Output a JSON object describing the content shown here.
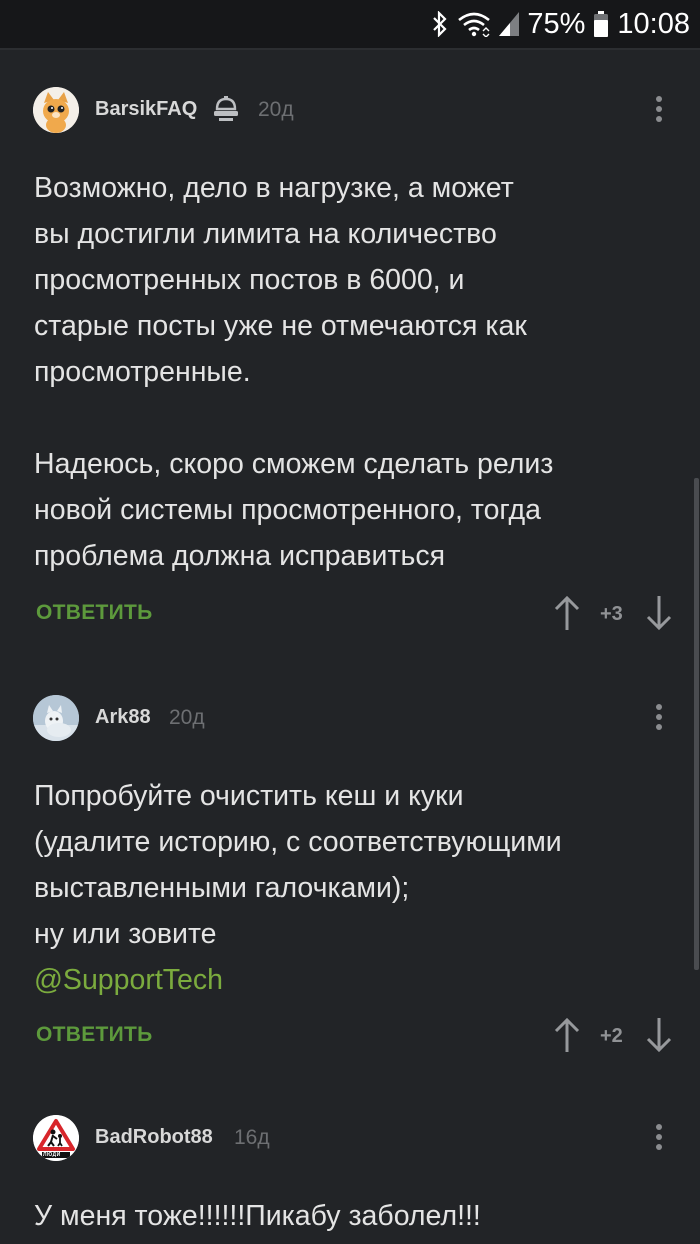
{
  "status_bar": {
    "icons": [
      "bluetooth-icon",
      "wifi-icon",
      "signal-icon",
      "battery-icon"
    ],
    "battery": "75%",
    "time": "10:08"
  },
  "comments": [
    {
      "author": "BarsikFAQ",
      "badge_icon": "moderator-hat-icon",
      "time": "20д",
      "paragraphs": [
        "Возможно, дело в нагрузке, а может",
        "вы достигли лимита на количество",
        "просмотренных постов в 6000, и",
        "старые посты уже не отмечаются как",
        "просмотренные.",
        "",
        "Надеюсь, скоро сможем сделать релиз",
        "новой системы просмотренного, тогда",
        "проблема должна исправиться"
      ],
      "reply_label": "ОТВЕТИТЬ",
      "score": "+3"
    },
    {
      "author": "Ark88",
      "time": "20д",
      "paragraphs": [
        "Попробуйте очистить кеш и куки",
        "(удалите историю, с соответствующими",
        "выставленными галочками);",
        "ну или зовите"
      ],
      "mention": "@SupportTech",
      "reply_label": "ОТВЕТИТЬ",
      "score": "+2"
    },
    {
      "author": "BadRobot88",
      "time": "16д",
      "paragraphs": [
        "У меня тоже!!!!!!Пикабу заболел!!!"
      ],
      "avatar_sign_text": "ЛЮДИ"
    }
  ],
  "colors": {
    "background": "#222427",
    "reply": "#5d9a3c",
    "mention": "#7bab3e"
  }
}
